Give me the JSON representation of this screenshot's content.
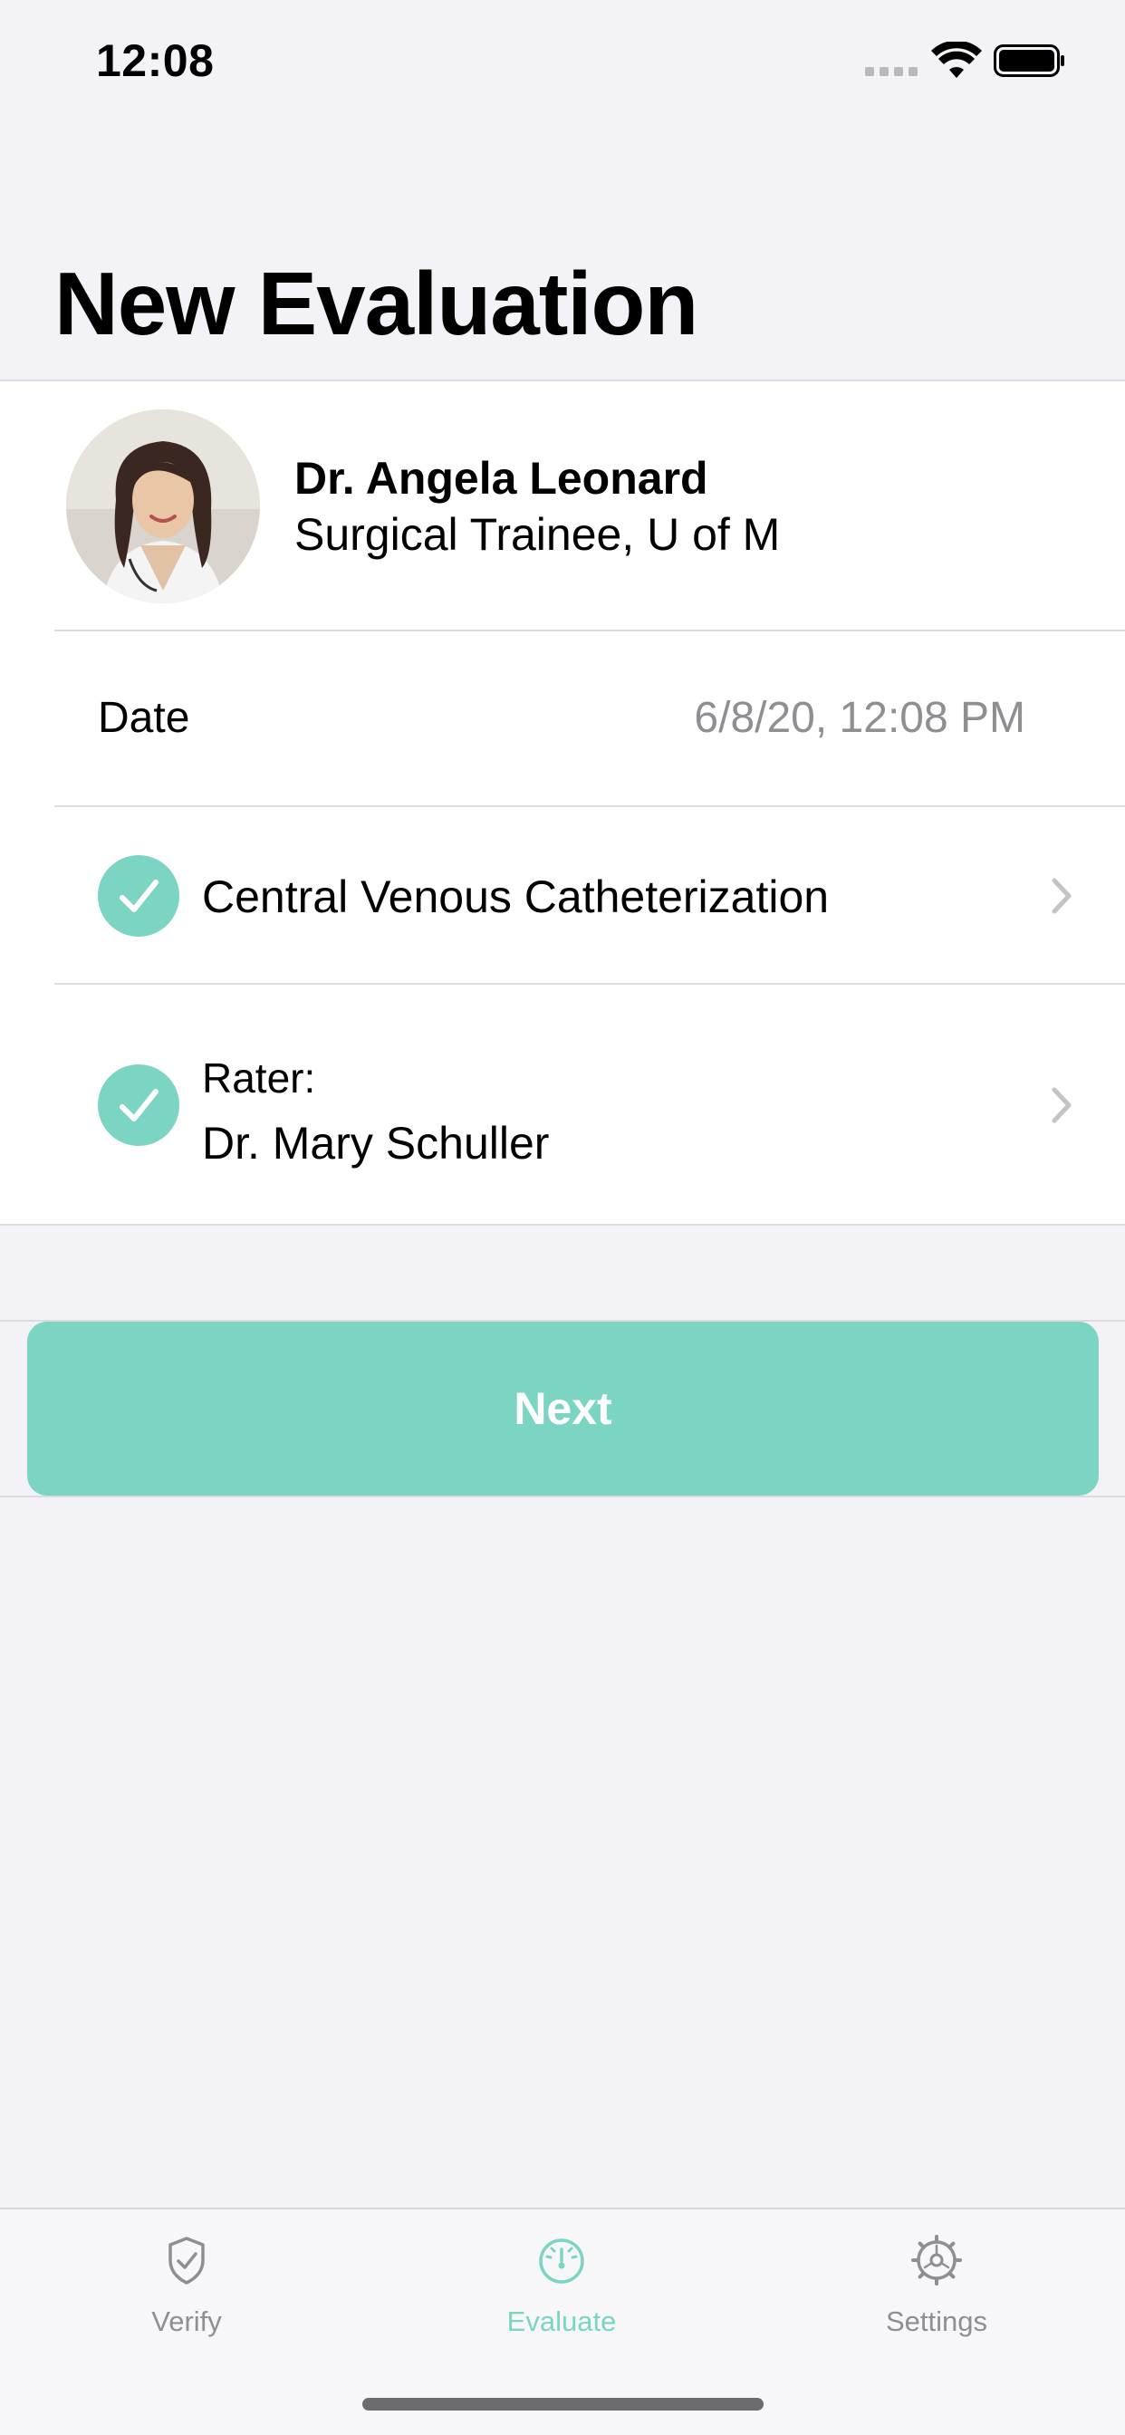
{
  "status_bar": {
    "time": "12:08"
  },
  "header": {
    "title": "New Evaluation"
  },
  "trainee": {
    "name": "Dr. Angela Leonard",
    "subtitle": "Surgical Trainee, U of M",
    "avatar_icon": "person-photo"
  },
  "date_row": {
    "label": "Date",
    "value": "6/8/20, 12:08 PM"
  },
  "procedure_row": {
    "label": "Central Venous Catheterization",
    "status_icon": "checkmark-circle-icon",
    "completed": true
  },
  "rater_row": {
    "label": "Rater:",
    "name": "Dr. Mary Schuller",
    "status_icon": "checkmark-circle-icon",
    "completed": true
  },
  "actions": {
    "next_label": "Next"
  },
  "tab_bar": {
    "tabs": [
      {
        "label": "Verify",
        "icon": "shield-check-icon",
        "selected": false
      },
      {
        "label": "Evaluate",
        "icon": "gauge-icon",
        "selected": true
      },
      {
        "label": "Settings",
        "icon": "gear-icon",
        "selected": false
      }
    ]
  },
  "colors": {
    "accent": "#7bd5c2",
    "background": "#f2f2f7",
    "secondary_text": "#8e8e93"
  }
}
